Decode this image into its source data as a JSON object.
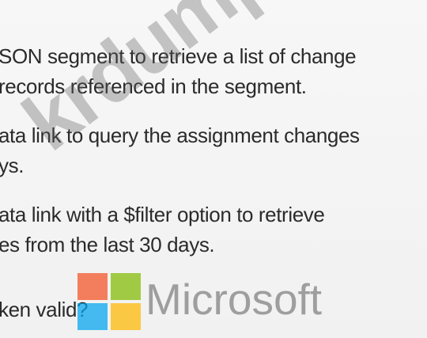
{
  "document": {
    "lines": [
      "SON segment to retrieve a list of change",
      "records referenced in the segment.",
      "ata link to query the assignment changes",
      "ys.",
      "ata link with a $filter option to retrieve",
      "es from the last 30 days.",
      "ken valid?"
    ]
  },
  "watermark": {
    "text": "krdump.com"
  },
  "logo": {
    "wordmark": "Microsoft",
    "colors": [
      "#f25022",
      "#7fba00",
      "#00a4ef",
      "#ffb900"
    ]
  }
}
